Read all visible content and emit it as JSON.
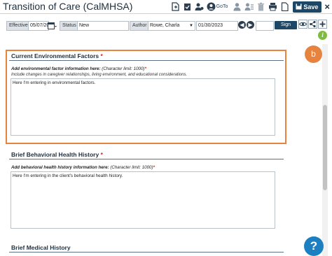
{
  "window": {
    "title": "Transition of Care (CalMHSA)",
    "goto_label": "GoTo",
    "save_label": "Save",
    "close_label": "×"
  },
  "toolbar": {
    "effective_label": "Effective",
    "effective_value": "05/07/20",
    "status_label": "Status",
    "status_value": "New",
    "author_label": "Author",
    "author_value": "Rowe, Charla",
    "date_value": "01/30/2023",
    "sign_label": "Sign"
  },
  "sections": {
    "env": {
      "title": "Current Environmental Factors",
      "required_mark": "*",
      "instruction_bold": "Add environmental factor information here:",
      "instruction_limit": " (Character limit: 1000)",
      "instruction_req": "*",
      "instruction_sub": "Include changes in caregiver relationships, living environment, and educational considerations.",
      "text": "Here I'm entering in environmental factors."
    },
    "behavioral": {
      "title": "Brief Behavioral Health History",
      "required_mark": "*",
      "instruction_bold": "Add behavioral health history information here:",
      "instruction_limit": " (Character limit: 1000)",
      "instruction_req": "*",
      "text": "Here I'm entering in the client's behavioral health history."
    },
    "medical": {
      "title": "Brief Medical History"
    }
  },
  "callout": {
    "badge_label": "b",
    "highlight_color": "#e7833f"
  },
  "help_label": "?",
  "info_label": "i",
  "colors": {
    "primary_button": "#1c4766",
    "required": "#d0261c",
    "info_green": "#7dbd3e",
    "help_blue": "#1b7fc1"
  },
  "icons": [
    "document-add-icon",
    "checklist-icon",
    "user-settings-icon",
    "goto-icon",
    "person-icon",
    "person-list-icon",
    "trash-icon",
    "print-icon",
    "document-icon",
    "save-icon",
    "close-icon",
    "calendar-icon",
    "back-arrow-icon",
    "forward-arrow-icon",
    "eye-icon",
    "share-icon",
    "plus-icon"
  ]
}
